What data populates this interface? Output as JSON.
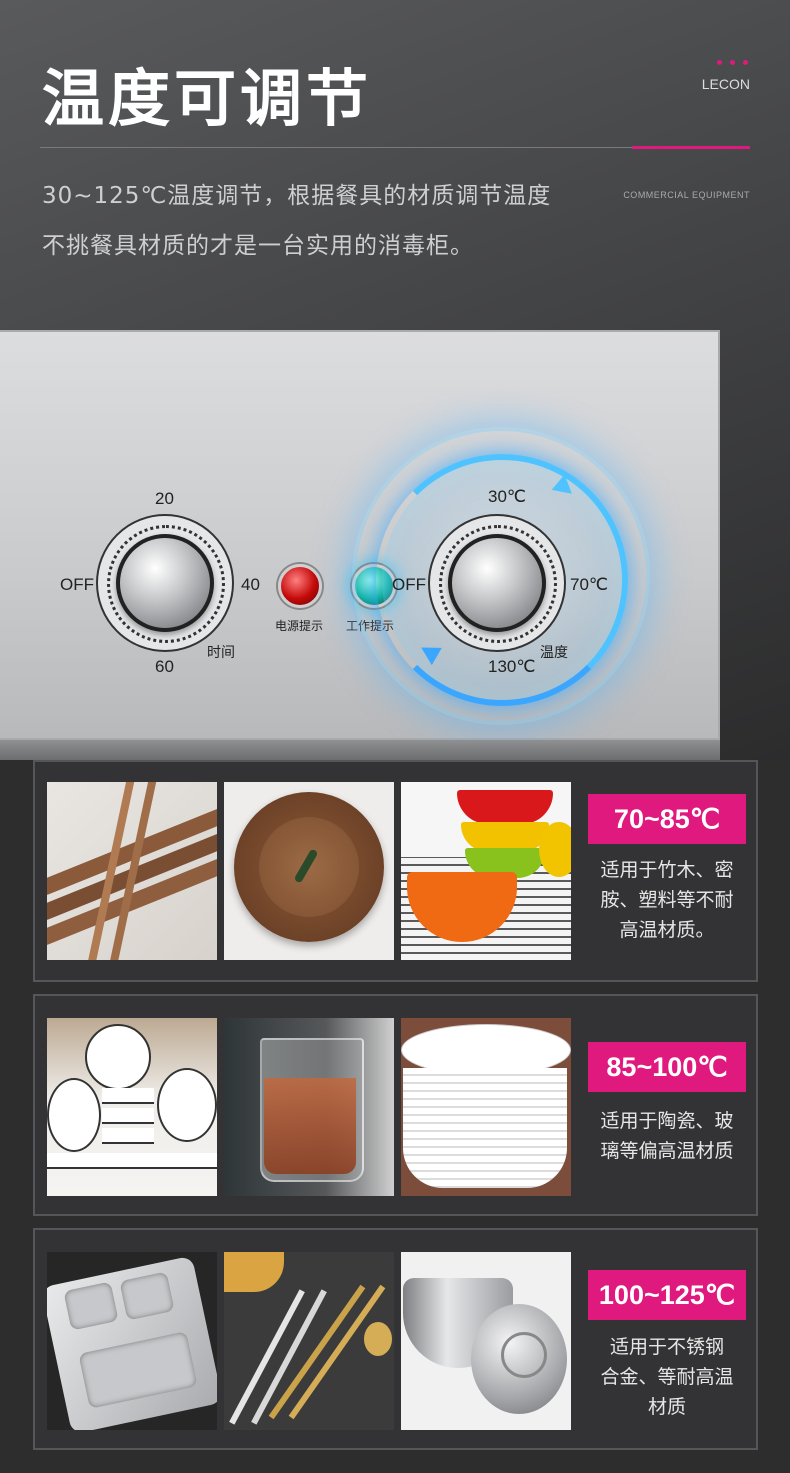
{
  "header": {
    "title": "温度可调节",
    "brand": "LECON",
    "subtitle_line1": "30~125℃温度调节，根据餐具的材质调节温度",
    "subtitle_line2": "不挑餐具材质的才是一台实用的消毒柜。",
    "tagline": "COMMERCIAL EQUIPMENT"
  },
  "control_panel": {
    "timer_dial": {
      "top": "20",
      "right": "40",
      "bottom": "60",
      "left": "OFF",
      "caption": "时间"
    },
    "power_light_label": "电源提示",
    "work_light_label": "工作提示",
    "temp_dial": {
      "top": "30℃",
      "right": "70℃",
      "bottom": "130℃",
      "left": "OFF",
      "caption": "温度"
    }
  },
  "materials": [
    {
      "range": "70~85℃",
      "desc": [
        "适用于竹木、密",
        "胺、塑料等不耐",
        "高温材质。"
      ],
      "photos": [
        "chopsticks",
        "wooden-plates",
        "plastic-bowls"
      ]
    },
    {
      "range": "85~100℃",
      "desc": [
        "适用于陶瓷、玻",
        "璃等偏高温材质"
      ],
      "photos": [
        "ceramic-bowls",
        "glass-cup",
        "plate-stack"
      ]
    },
    {
      "range": "100~125℃",
      "desc": [
        "适用于不锈钢",
        "合金、等耐高温",
        "材质"
      ],
      "photos": [
        "steel-tray",
        "cutlery",
        "steel-bowls"
      ]
    }
  ],
  "colors": {
    "accent": "#e0197e",
    "glow": "#3fb8f0",
    "background": "#2d2d2e"
  }
}
